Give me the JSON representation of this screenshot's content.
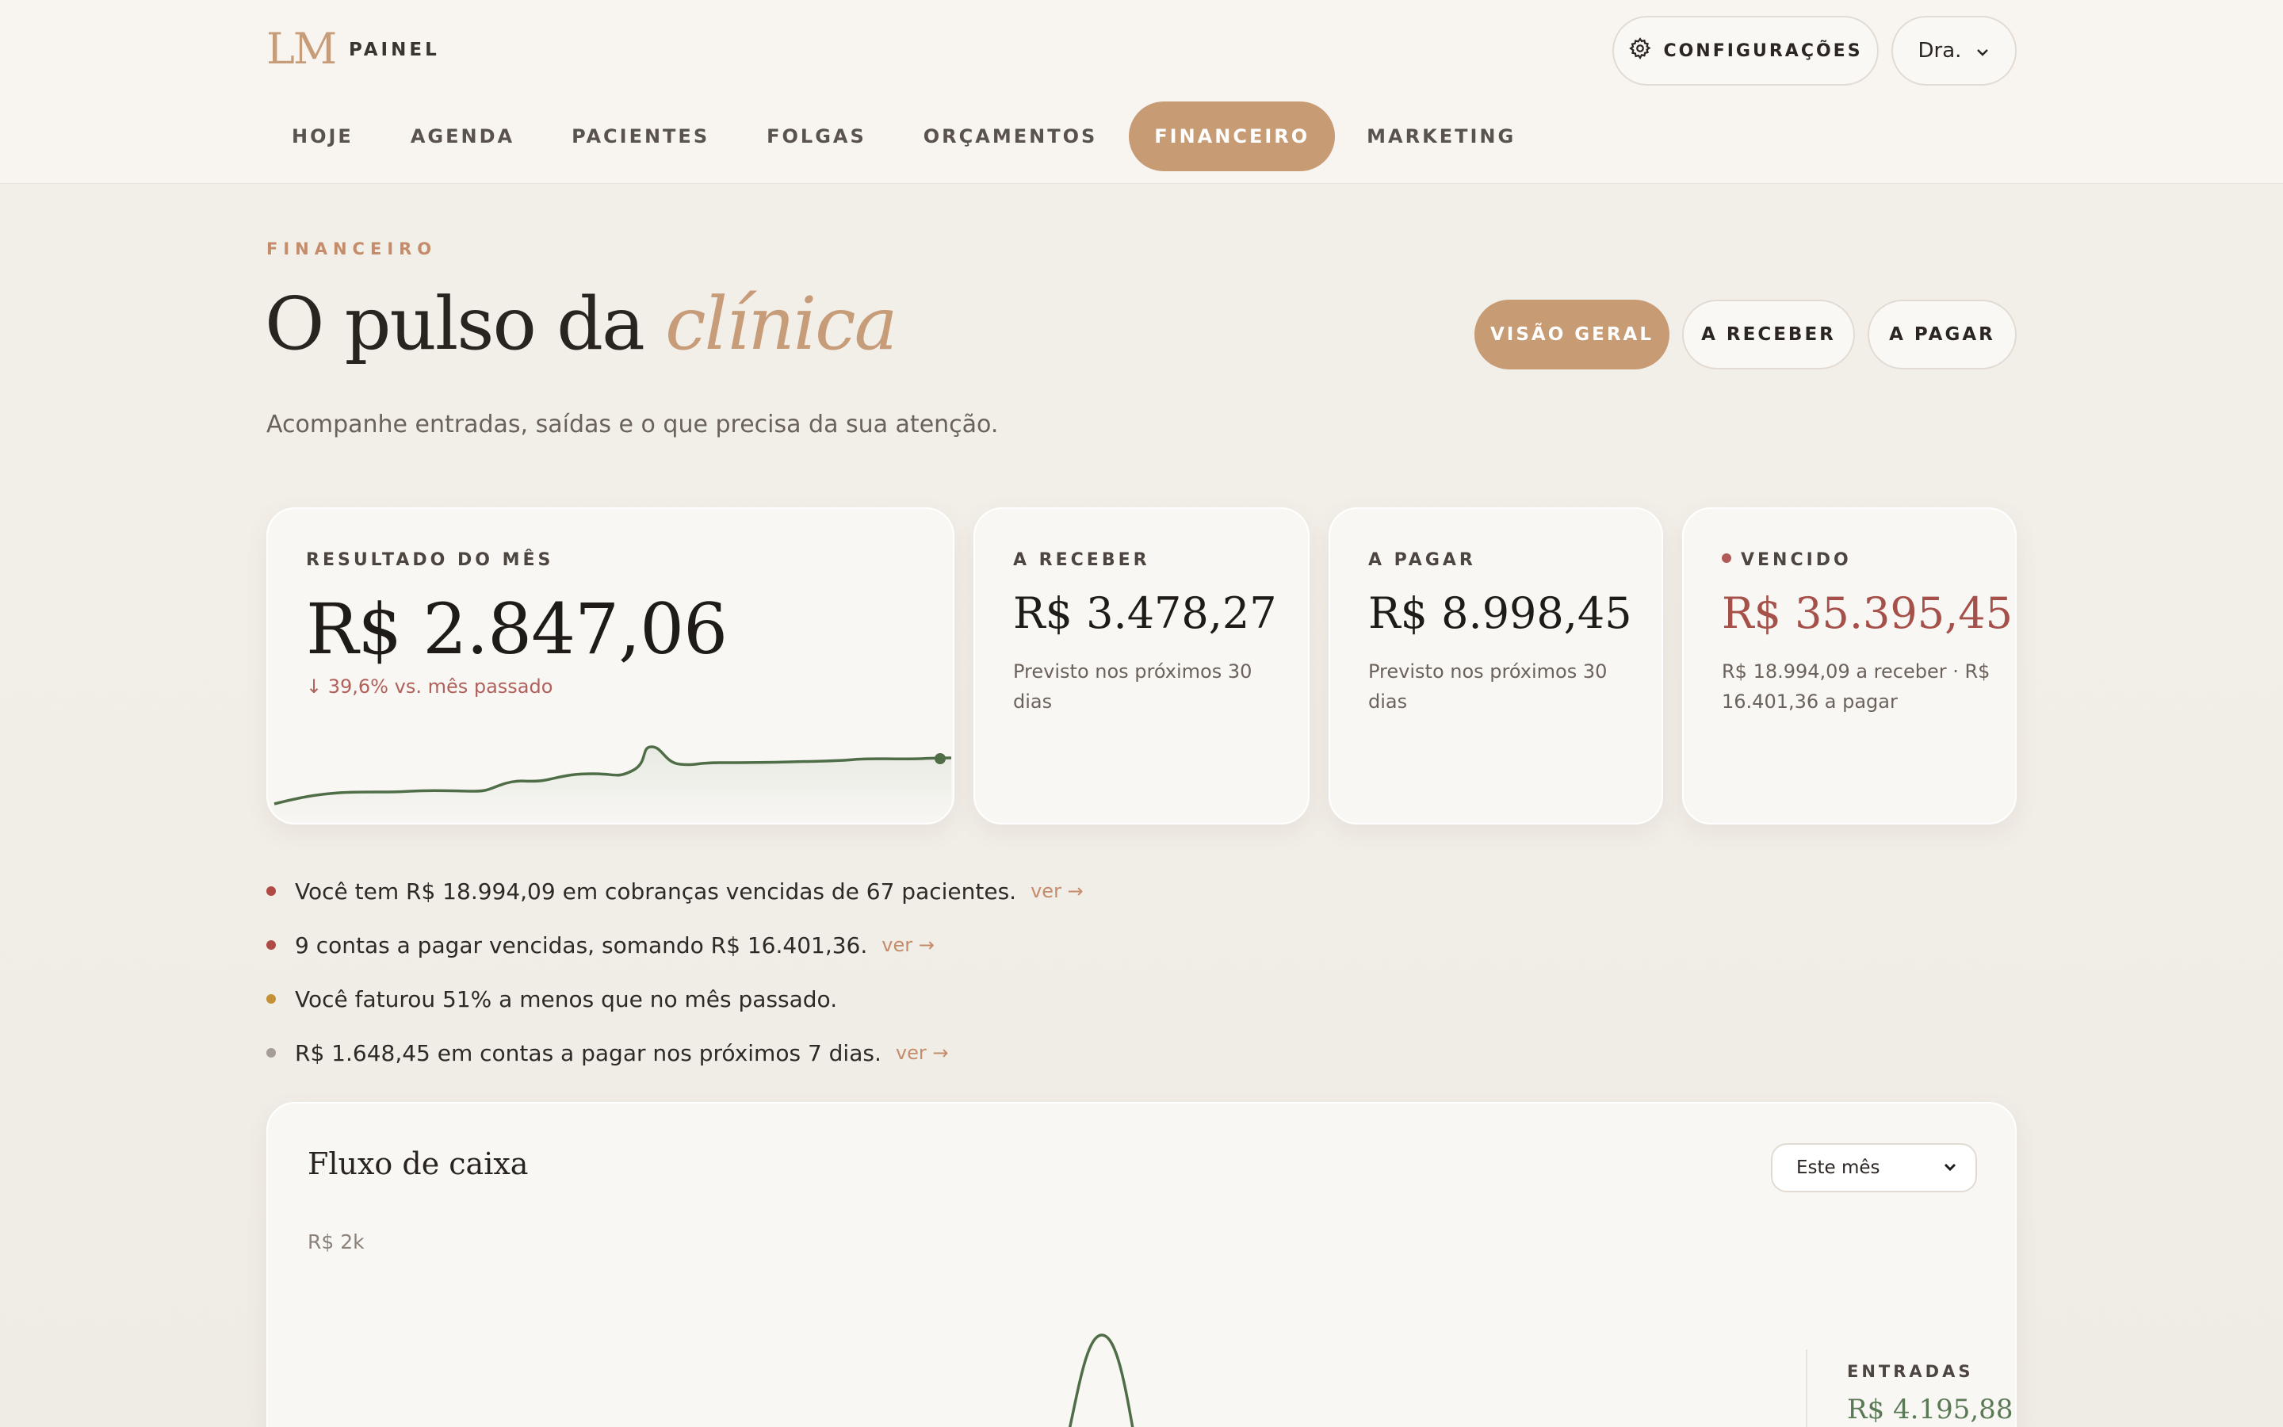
{
  "brand": {
    "logo": "LM",
    "label": "PAINEL"
  },
  "header": {
    "settings_label": "CONFIGURAÇÕES",
    "user_label": "Dra."
  },
  "nav": {
    "items": [
      {
        "label": "HOJE"
      },
      {
        "label": "AGENDA"
      },
      {
        "label": "PACIENTES"
      },
      {
        "label": "FOLGAS"
      },
      {
        "label": "ORÇAMENTOS"
      },
      {
        "label": "FINANCEIRO",
        "active": true
      },
      {
        "label": "MARKETING"
      }
    ]
  },
  "page": {
    "eyebrow": "FINANCEIRO",
    "title_main": "O pulso da ",
    "title_accent": "clínica",
    "subtitle": "Acompanhe entradas, saídas e o que precisa da sua atenção.",
    "segments": [
      {
        "label": "VISÃO GERAL",
        "active": true
      },
      {
        "label": "A RECEBER"
      },
      {
        "label": "A PAGAR"
      }
    ]
  },
  "cards": {
    "result": {
      "label": "RESULTADO DO MÊS",
      "value": "R$ 2.847,06",
      "delta": "↓ 39,6% vs. mês passado"
    },
    "receivable": {
      "label": "A RECEBER",
      "value": "R$ 3.478,27",
      "note": "Previsto nos próximos 30 dias"
    },
    "payable": {
      "label": "A PAGAR",
      "value": "R$ 8.998,45",
      "note": "Previsto nos próximos 30 dias"
    },
    "overdue": {
      "label": "VENCIDO",
      "value": "R$ 35.395,45",
      "note": "R$ 18.994,09 a receber · R$ 16.401,36 a pagar"
    }
  },
  "alerts": [
    {
      "text": "Você tem R$ 18.994,09 em cobranças vencidas de 67 pacientes.",
      "link": "ver →",
      "level": "red"
    },
    {
      "text": "9 contas a pagar vencidas, somando R$ 16.401,36.",
      "link": "ver →",
      "level": "red"
    },
    {
      "text": "Você faturou 51% a menos que no mês passado.",
      "link": "",
      "level": "gold"
    },
    {
      "text": "R$ 1.648,45 em contas a pagar nos próximos 7 dias.",
      "link": "ver →",
      "level": "gray"
    }
  ],
  "cashflow": {
    "title": "Fluxo de caixa",
    "period": "Este mês",
    "y_tick": "R$ 2k",
    "side_label": "ENTRADAS",
    "side_value": "R$ 4.195,88"
  },
  "colors": {
    "accent": "#c79b74",
    "danger": "#a6504a",
    "chart_line": "#4f6e48",
    "background": "#f3efe9"
  }
}
